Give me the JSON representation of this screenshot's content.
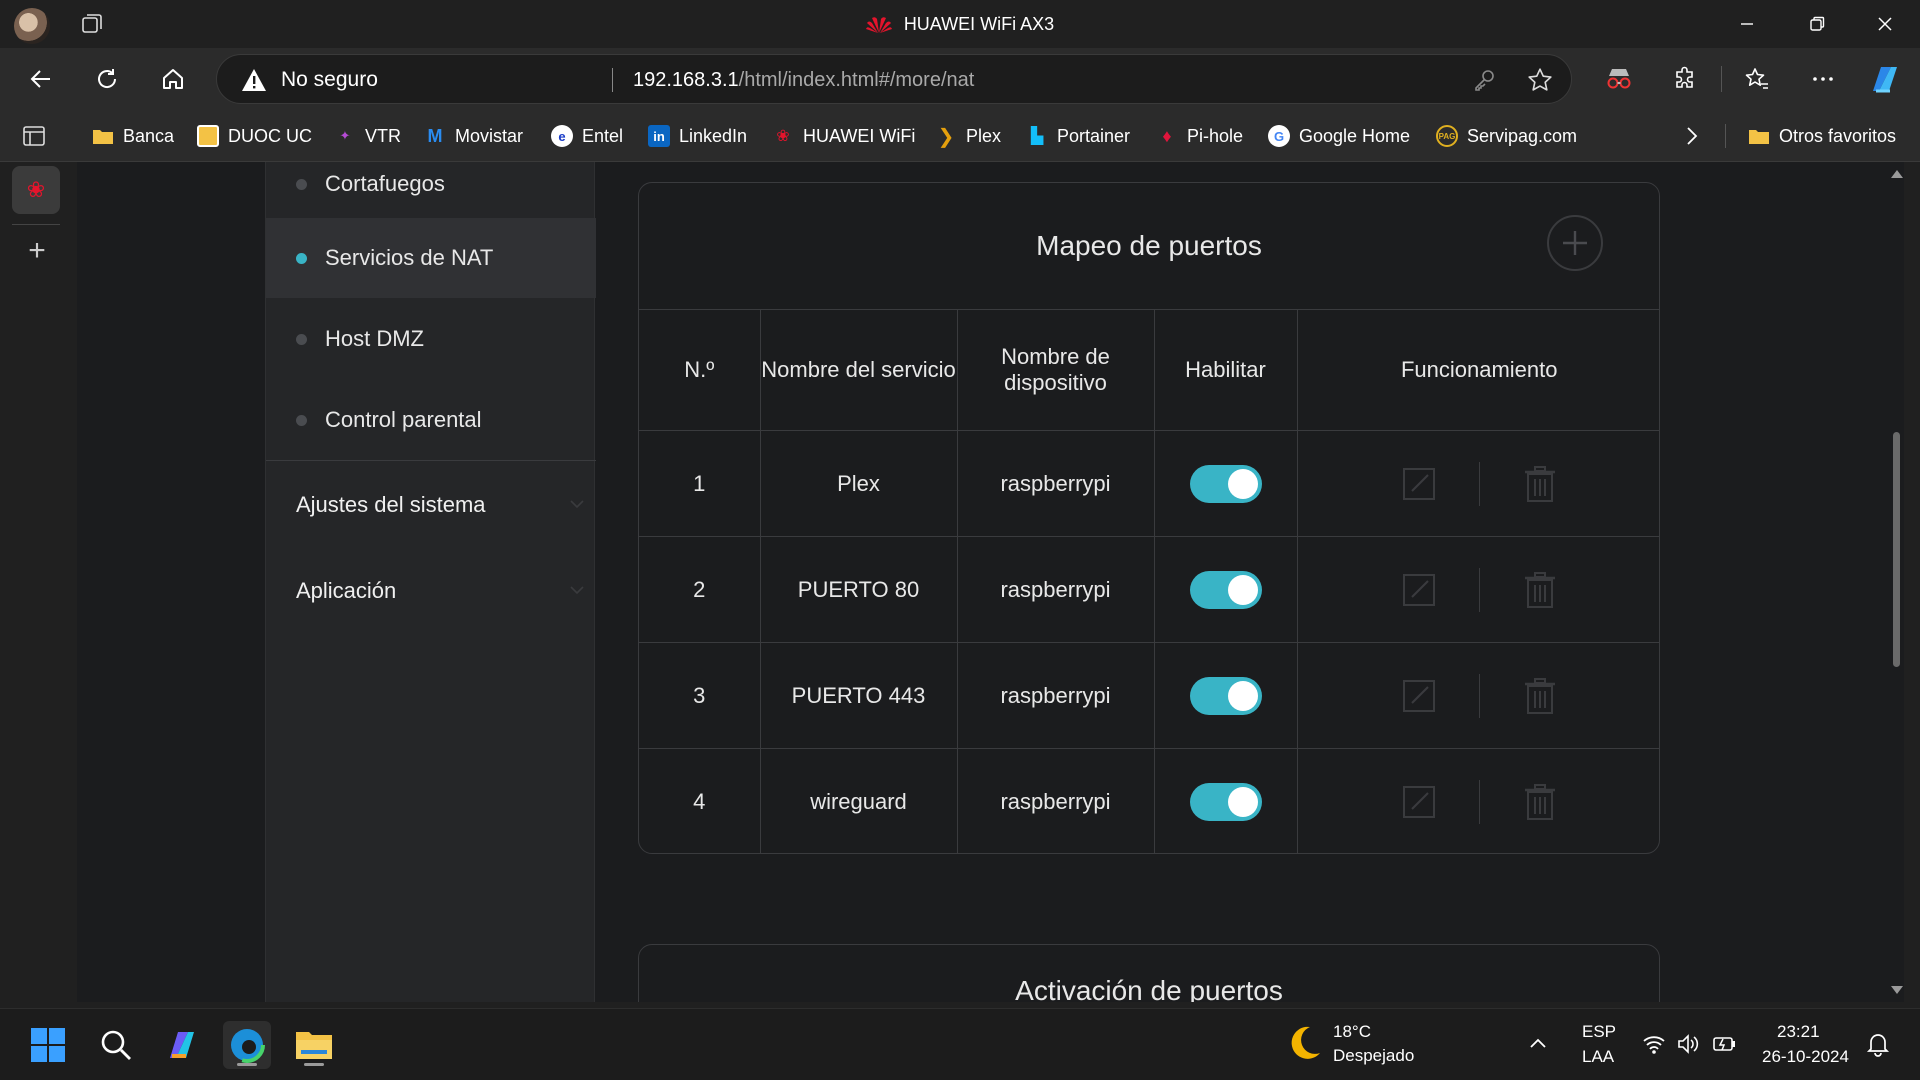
{
  "window": {
    "title": "HUAWEI WiFi AX3"
  },
  "address_bar": {
    "security_label": "No seguro",
    "url_host": "192.168.3.1",
    "url_path": "/html/index.html#/more/nat"
  },
  "bookmarks": [
    {
      "label": "Banca",
      "icon": "folder-icon"
    },
    {
      "label": "DUOC UC",
      "icon": "duoc-icon"
    },
    {
      "label": "VTR",
      "icon": "vtr-icon"
    },
    {
      "label": "Movistar",
      "icon": "movistar-icon"
    },
    {
      "label": "Entel",
      "icon": "entel-icon"
    },
    {
      "label": "LinkedIn",
      "icon": "linkedin-icon"
    },
    {
      "label": "HUAWEI WiFi",
      "icon": "huawei-icon"
    },
    {
      "label": "Plex",
      "icon": "plex-icon"
    },
    {
      "label": "Portainer",
      "icon": "portainer-icon"
    },
    {
      "label": "Pi-hole",
      "icon": "pihole-icon"
    },
    {
      "label": "Google Home",
      "icon": "google-icon"
    },
    {
      "label": "Servipag.com",
      "icon": "servipag-icon"
    }
  ],
  "bookmarks_other": "Otros favoritos",
  "menu": {
    "items": [
      {
        "label": "Cortafuegos",
        "active": false
      },
      {
        "label": "Servicios de NAT",
        "active": true
      },
      {
        "label": "Host DMZ",
        "active": false
      },
      {
        "label": "Control parental",
        "active": false
      }
    ],
    "sections": [
      {
        "label": "Ajustes del sistema"
      },
      {
        "label": "Aplicación"
      }
    ]
  },
  "port_mapping": {
    "title": "Mapeo de puertos",
    "columns": [
      "N.º",
      "Nombre del servicio",
      "Nombre de dispositivo",
      "Habilitar",
      "Funcionamiento"
    ],
    "rows": [
      {
        "no": "1",
        "service": "Plex",
        "device": "raspberrypi",
        "enabled": true
      },
      {
        "no": "2",
        "service": "PUERTO 80",
        "device": "raspberrypi",
        "enabled": true
      },
      {
        "no": "3",
        "service": "PUERTO 443",
        "device": "raspberrypi",
        "enabled": true
      },
      {
        "no": "4",
        "service": "wireguard",
        "device": "raspberrypi",
        "enabled": true
      }
    ]
  },
  "next_card_title": "Activación de puertos",
  "taskbar": {
    "weather_temp": "18°C",
    "weather_desc": "Despejado",
    "lang_top": "ESP",
    "lang_bottom": "LAA",
    "time": "23:21",
    "date": "26-10-2024"
  },
  "colors": {
    "accent": "#39b4c6",
    "huawei_red": "#e4142c",
    "background": "#1b1c1e"
  }
}
